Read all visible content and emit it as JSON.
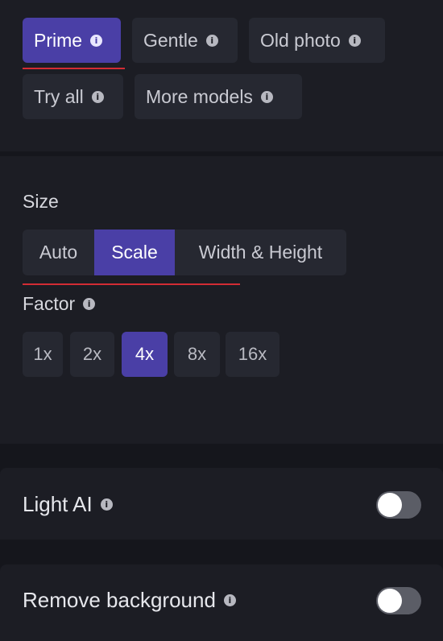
{
  "models": {
    "items": [
      {
        "label": "Prime",
        "active": true
      },
      {
        "label": "Gentle",
        "active": false
      },
      {
        "label": "Old photo",
        "active": false
      },
      {
        "label": "Try all",
        "active": false
      },
      {
        "label": "More models",
        "active": false
      }
    ]
  },
  "size": {
    "title": "Size",
    "options": [
      "Auto",
      "Scale",
      "Width & Height"
    ],
    "selected": "Scale"
  },
  "factor": {
    "title": "Factor",
    "options": [
      "1x",
      "2x",
      "4x",
      "8x",
      "16x"
    ],
    "selected": "4x"
  },
  "light_ai": {
    "label": "Light AI",
    "enabled": false
  },
  "remove_background": {
    "label": "Remove background",
    "enabled": false
  },
  "info_glyph": "i",
  "colors": {
    "accent": "#4a3fa6",
    "underline": "#d22c34",
    "background": "#1c1d24"
  }
}
